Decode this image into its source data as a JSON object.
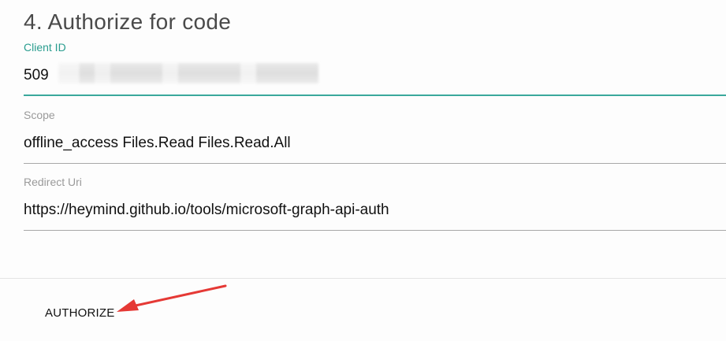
{
  "section": {
    "title": "4. Authorize for code"
  },
  "fields": {
    "client_id": {
      "label": "Client ID",
      "value": "509"
    },
    "scope": {
      "label": "Scope",
      "value": "offline_access Files.Read Files.Read.All"
    },
    "redirect_uri": {
      "label": "Redirect Uri",
      "value": "https://heymind.github.io/tools/microsoft-graph-api-auth"
    }
  },
  "actions": {
    "authorize_label": "AUTHORIZE"
  },
  "colors": {
    "accent": "#3aa89c",
    "annotation_arrow": "#e53935"
  }
}
